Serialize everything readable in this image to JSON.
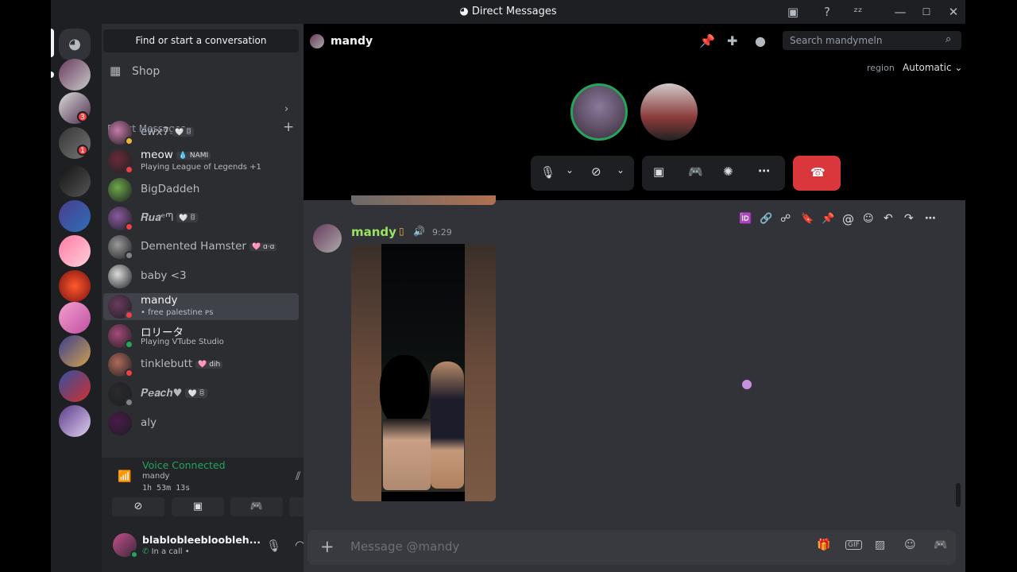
{
  "window": {
    "title": "Direct Messages"
  },
  "sidebar": {
    "search_label": "Find or start a conversation",
    "shop_label": "Shop",
    "dm_header": "Direct Messages",
    "dms": [
      {
        "name": "ewx7",
        "tags": "🤍 ꊞ",
        "activity": "",
        "status": "idle"
      },
      {
        "name": "meow",
        "tags": "💧 NAMI",
        "activity": "Playing League of Legends +1",
        "status": "dnd"
      },
      {
        "name": "BigDaddeh",
        "tags": "",
        "activity": "",
        "status": "none"
      },
      {
        "name": "𝑹𝒖𝒂ᵉᘉ",
        "tags": "🤍 ꊞ",
        "activity": "",
        "status": "dnd"
      },
      {
        "name": "Demented Hamster",
        "tags": "🩷 ɑ·ɑ",
        "activity": "",
        "status": "offline"
      },
      {
        "name": "baby <3",
        "tags": "",
        "activity": "",
        "status": "none"
      },
      {
        "name": "mandy",
        "tags": "",
        "activity": "• free palestine ᴘs",
        "status": "dnd"
      },
      {
        "name": "ロリータ",
        "tags": "",
        "activity": "Playing VTube Studio",
        "status": "online"
      },
      {
        "name": "tinklebutt",
        "tags": "🩷 dih",
        "activity": "",
        "status": "dnd"
      },
      {
        "name": "𝑷𝒆𝒂𝒄𝒉♥",
        "tags": "🤍 ꊞ",
        "activity": "",
        "status": "offline"
      },
      {
        "name": "aly",
        "tags": "",
        "activity": "",
        "status": "none"
      }
    ]
  },
  "voice": {
    "status": "Voice Connected",
    "channel": "mandy",
    "duration": "1h 53m 13s"
  },
  "user": {
    "name": "blablobleebloobleh...",
    "status": "In a call •"
  },
  "header": {
    "channel_name": "mandy",
    "search_placeholder": "Search mandymeln",
    "region_label": "region",
    "region_value": "Automatic"
  },
  "message": {
    "author": "mandy",
    "time": "9:29"
  },
  "composer": {
    "placeholder": "Message @mandy"
  },
  "server_badges": {
    "a": "3",
    "b": "1"
  },
  "colors": {
    "accent_green": "#23a55a",
    "danger_red": "#da373c",
    "author_green": "#9ae362"
  }
}
